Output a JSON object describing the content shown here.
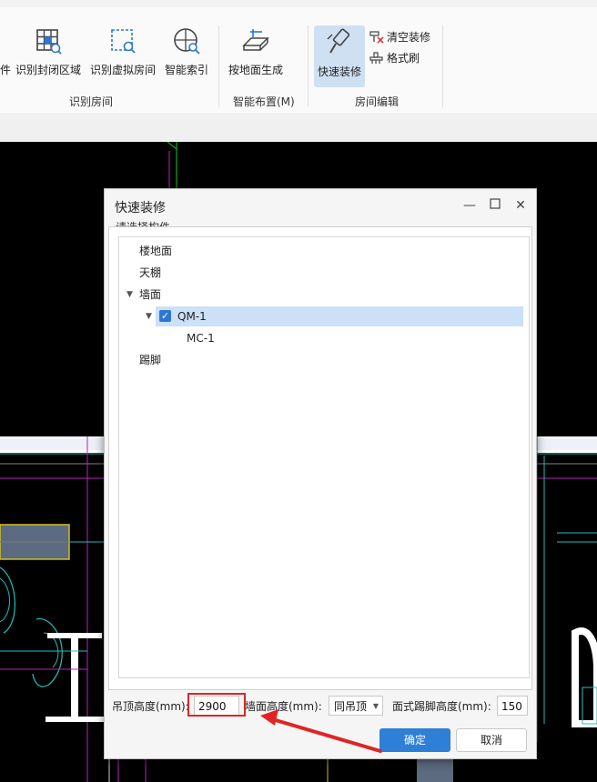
{
  "ribbon": {
    "buttons": [
      {
        "label": "件"
      },
      {
        "label": "识别封闭区域"
      },
      {
        "label": "识别虚拟房间"
      },
      {
        "label": "智能索引"
      },
      {
        "label": "按地面生成"
      },
      {
        "label": "快速装修"
      }
    ],
    "small_buttons": {
      "clear": "清空装修",
      "format": "格式刷"
    },
    "groups": {
      "recognize": "识别房间",
      "smart": "智能布置(M)",
      "edit": "房间编辑"
    }
  },
  "dialog": {
    "title": "快速装修",
    "section_label": "请选择构件",
    "tree": [
      {
        "label": "楼地面"
      },
      {
        "label": "天棚"
      },
      {
        "label": "墙面"
      },
      {
        "label": "QM-1"
      },
      {
        "label": "MC-1"
      },
      {
        "label": "踢脚"
      }
    ],
    "ceiling_height_label": "吊顶高度(mm):",
    "ceiling_height_value": "2900",
    "wall_height_label": "墙面高度(mm):",
    "wall_height_value": "同吊顶",
    "skirting_label": "面式踢脚高度(mm):",
    "skirting_value": "150",
    "ok": "确定",
    "cancel": "取消"
  },
  "colors": {
    "accent": "#2e7fd8",
    "selection": "#cce0f7",
    "annotation": "#e02424"
  }
}
